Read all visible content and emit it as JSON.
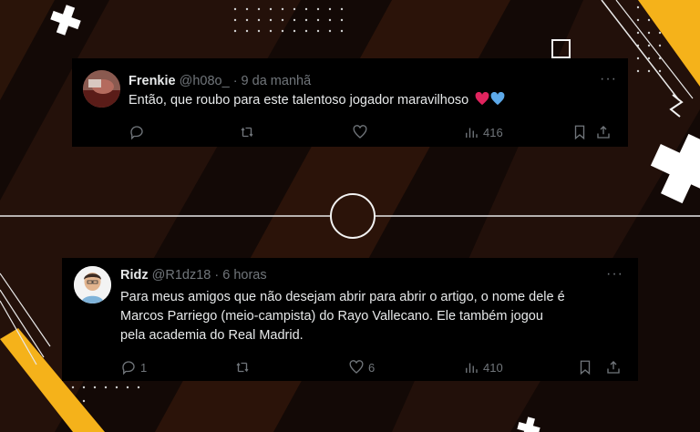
{
  "tweets": [
    {
      "name": "Frenkie",
      "handle": "@h08o_",
      "time": "· 9 da manhã",
      "text": "Então, que roubo para este talentoso jogador maravilhoso",
      "emojis": [
        "red-heart",
        "blue-heart"
      ],
      "replies": "",
      "retweets": "",
      "likes": "",
      "views": "416"
    },
    {
      "name": "Ridz",
      "handle": "@R1dz18",
      "time": "· 6 horas",
      "text_lines": [
        "Para meus amigos que não desejam abrir para abrir o artigo, o nome dele é",
        "Marcos Parriego (meio-campista) do Rayo Vallecano. Ele também jogou",
        "pela academia do Real Madrid."
      ],
      "replies": "1",
      "retweets": "",
      "likes": "6",
      "views": "410"
    }
  ],
  "more_label": "···",
  "colors": {
    "accent_yellow": "#f5b21a",
    "tweet_bg": "#000000",
    "text": "#e7e9ea",
    "muted": "#71767b",
    "heart_red": "#e0245e",
    "heart_blue": "#5da9e9"
  }
}
